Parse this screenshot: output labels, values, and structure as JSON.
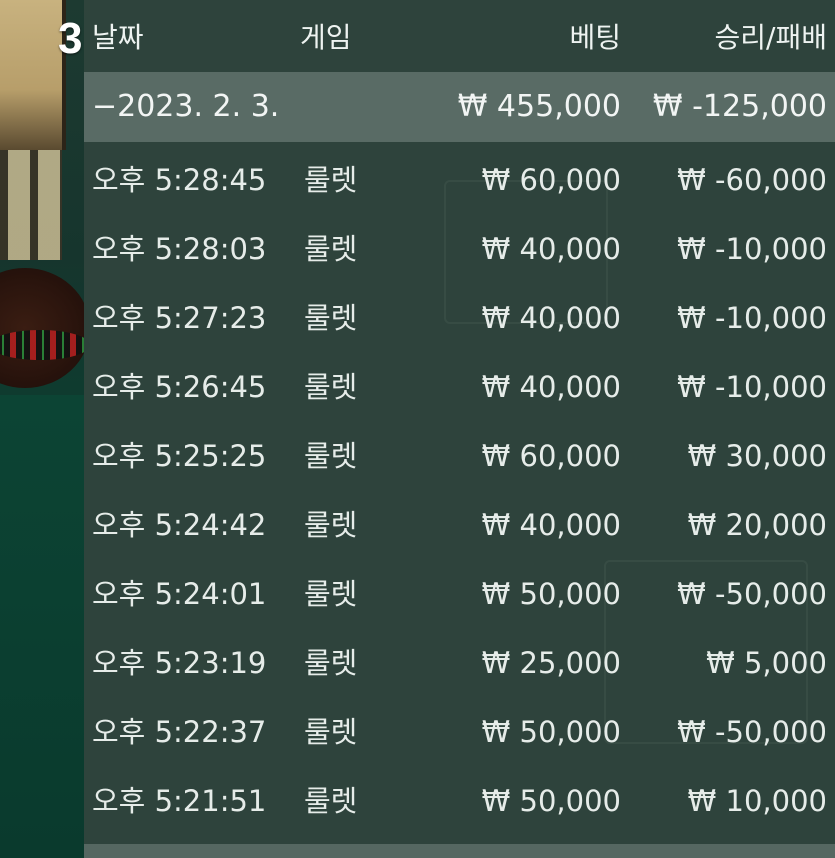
{
  "overlay_number": "3",
  "header": {
    "date": "날짜",
    "game": "게임",
    "bet": "베팅",
    "result": "승리/패배"
  },
  "summary": {
    "date": "−2023. 2. 3.",
    "bet": "₩ 455,000",
    "result": "₩ -125,000"
  },
  "rows": [
    {
      "time": "오후 5:28:45",
      "game": "룰렛",
      "bet": "₩ 60,000",
      "result": "₩ -60,000"
    },
    {
      "time": "오후 5:28:03",
      "game": "룰렛",
      "bet": "₩ 40,000",
      "result": "₩ -10,000"
    },
    {
      "time": "오후 5:27:23",
      "game": "룰렛",
      "bet": "₩ 40,000",
      "result": "₩ -10,000"
    },
    {
      "time": "오후 5:26:45",
      "game": "룰렛",
      "bet": "₩ 40,000",
      "result": "₩ -10,000"
    },
    {
      "time": "오후 5:25:25",
      "game": "룰렛",
      "bet": "₩ 60,000",
      "result": "₩ 30,000"
    },
    {
      "time": "오후 5:24:42",
      "game": "룰렛",
      "bet": "₩ 40,000",
      "result": "₩ 20,000"
    },
    {
      "time": "오후 5:24:01",
      "game": "룰렛",
      "bet": "₩ 50,000",
      "result": "₩ -50,000"
    },
    {
      "time": "오후 5:23:19",
      "game": "룰렛",
      "bet": "₩ 25,000",
      "result": "₩ 5,000"
    },
    {
      "time": "오후 5:22:37",
      "game": "룰렛",
      "bet": "₩ 50,000",
      "result": "₩ -50,000"
    },
    {
      "time": "오후 5:21:51",
      "game": "룰렛",
      "bet": "₩ 50,000",
      "result": "₩ 10,000"
    }
  ],
  "colors": {
    "panel": "#2f443d",
    "summary_highlight": "#7d8c87",
    "text": "#e6ece9"
  }
}
